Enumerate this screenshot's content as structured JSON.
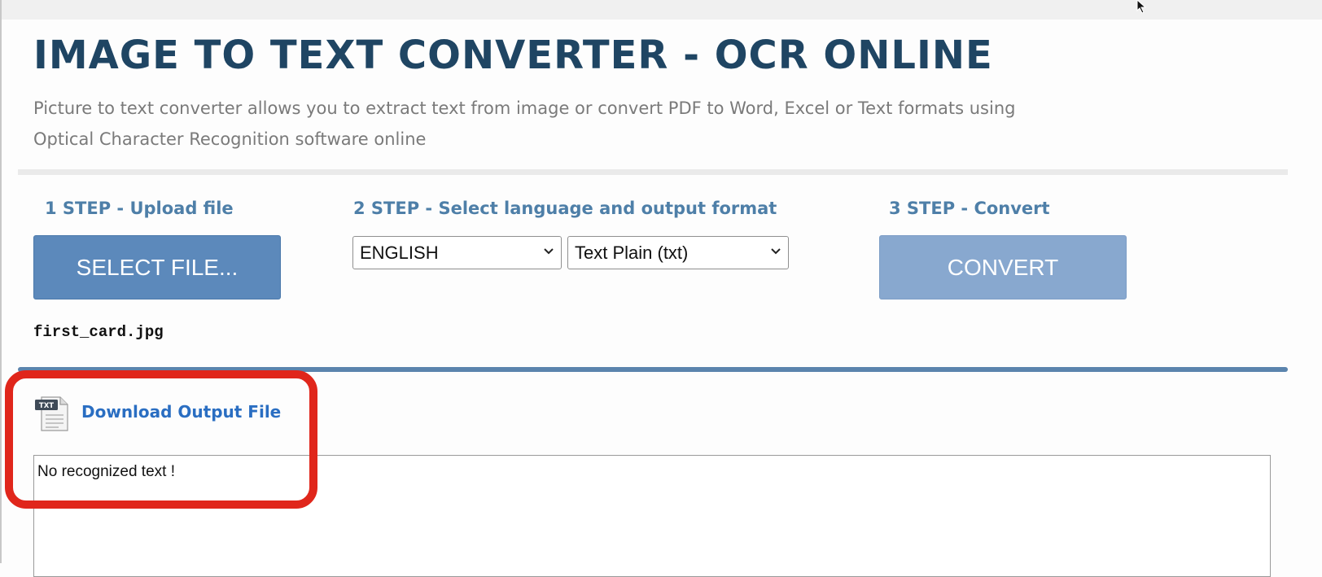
{
  "page": {
    "title": "IMAGE TO TEXT CONVERTER - OCR ONLINE",
    "subtitle": "Picture to text converter allows you to extract text from image or convert PDF to Word, Excel or Text formats using Optical Character Recognition software online"
  },
  "steps": {
    "step1": {
      "heading": "1 STEP - Upload file",
      "button_label": "SELECT FILE...",
      "file_name": "first_card.jpg"
    },
    "step2": {
      "heading": "2 STEP - Select language and output format",
      "language_selected": "ENGLISH",
      "format_selected": "Text Plain (txt)"
    },
    "step3": {
      "heading": "3 STEP - Convert",
      "button_label": "CONVERT"
    }
  },
  "output": {
    "icon_badge": "TXT",
    "download_label": "Download Output File",
    "result_text": "No recognized text !"
  },
  "colors": {
    "title": "#1f4563",
    "step_heading": "#4e7fa8",
    "select_button": "#5c89bb",
    "convert_button": "#88a8cf",
    "link": "#2a6ec2",
    "highlight": "#e0261b"
  },
  "icons": {
    "file": "txt-file-icon",
    "cursor": "mouse-cursor-icon",
    "dropdown": "chevron-down-icon"
  }
}
